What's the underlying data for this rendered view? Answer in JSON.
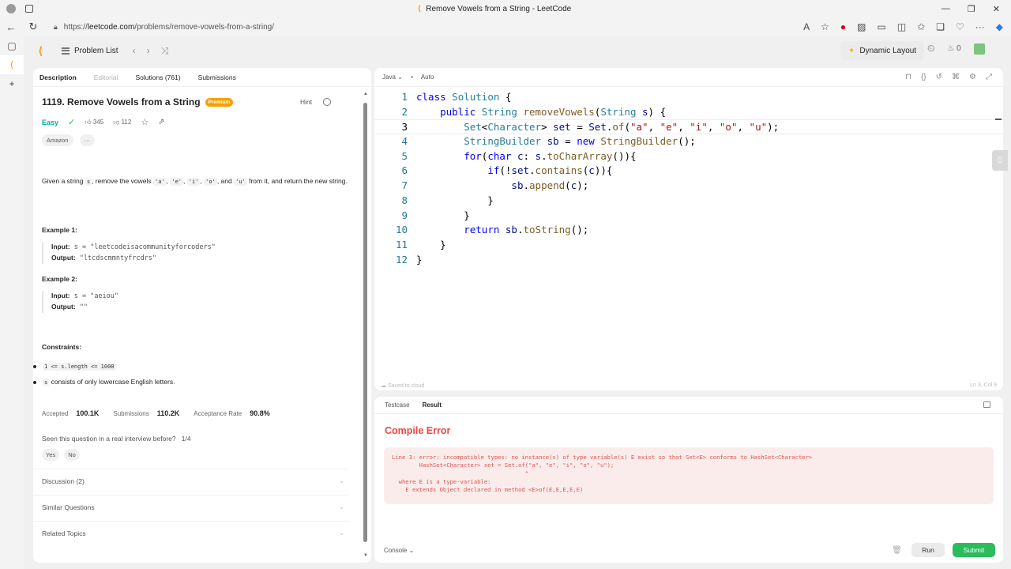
{
  "browser": {
    "window_title": "Remove Vowels from a String - LeetCode",
    "url_prefix": "https://",
    "url_domain": "leetcode.com",
    "url_path": "/problems/remove-vowels-from-a-string/",
    "zoom_icon": "text-size-icon"
  },
  "nav": {
    "problem_list": "Problem List",
    "dynamic_layout": "Dynamic Layout",
    "streak": "0"
  },
  "left_tabs": [
    "Description",
    "Editorial",
    "Solutions (761)",
    "Submissions"
  ],
  "problem": {
    "title": "1119. Remove Vowels from a String",
    "premium": "Premium",
    "hint": "Hint",
    "difficulty": "Easy",
    "likes": "345",
    "dislikes": "112",
    "company": "Amazon",
    "more": "···",
    "desc_1": "Given a string ",
    "desc_s": "s",
    "desc_2": ", remove the vowels ",
    "v_a": "'a'",
    "v_e": "'e'",
    "v_i": "'i'",
    "v_o": "'o'",
    "desc_and": ", and ",
    "v_u": "'u'",
    "desc_3": " from it, and return the new string.",
    "example1_title": "Example 1:",
    "example1_input_label": "Input:",
    "example1_input": "s = \"leetcodeisacommunityforcoders\"",
    "example1_output_label": "Output:",
    "example1_output": "\"ltcdscmmntyfrcdrs\"",
    "example2_title": "Example 2:",
    "example2_input_label": "Input:",
    "example2_input": "s = \"aeiou\"",
    "example2_output_label": "Output:",
    "example2_output": "\"\"",
    "constraints_title": "Constraints:",
    "constraint_1": "1 <= s.length <= 1000",
    "constraint_2_code": "s",
    "constraint_2_text": " consists of only lowercase English letters.",
    "accepted_label": "Accepted",
    "accepted": "100.1K",
    "submissions_label": "Submissions",
    "submissions": "110.2K",
    "rate_label": "Acceptance Rate",
    "rate": "90.8%",
    "seen": "Seen this question in a real interview before?",
    "seen_count": "1/4",
    "yes": "Yes",
    "no": "No",
    "discussion": "Discussion (2)",
    "similar": "Similar Questions",
    "related": "Related Topics"
  },
  "editor": {
    "language": "Java",
    "mode": "Auto",
    "saved": "Saved to cloud",
    "cursor": "Ln 3, Col 9"
  },
  "result": {
    "tab_testcase": "Testcase",
    "tab_result": "Result",
    "status": "Compile Error",
    "message": "Line 3: error: incompatible types: no instance(s) of type variable(s) E exist so that Set<E> conforms to HashSet<Character>\n        HashSet<Character> set = Set.of(\"a\", \"e\", \"i\", \"o\", \"u\");\n                                       ^\n  where E is a type-variable:\n    E extends Object declared in method <E>of(E,E,E,E,E)",
    "console": "Console",
    "run": "Run",
    "submit": "Submit"
  },
  "colors": {
    "accent_green": "#2cbb5d",
    "error_red": "#ef4743",
    "easy": "#00af9b",
    "premium": "#f5a200"
  }
}
